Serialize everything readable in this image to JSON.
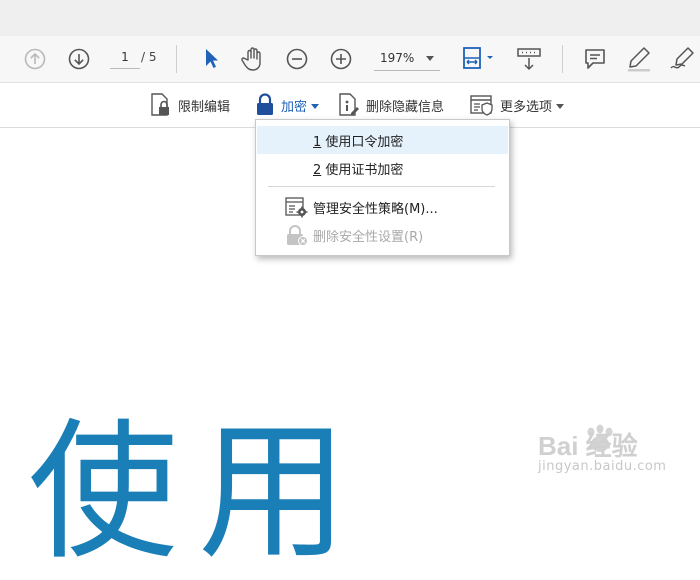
{
  "toolbar": {
    "page_current": "1",
    "page_total": "/ 5",
    "zoom": "197%",
    "icons": [
      "prev-page-icon",
      "next-page-icon",
      "select-arrow-icon",
      "hand-icon",
      "zoom-out-icon",
      "zoom-in-icon",
      "fit-page-icon",
      "scroll-mode-icon",
      "comment-icon",
      "highlight-pen-icon",
      "sign-icon"
    ]
  },
  "security_bar": {
    "restrict_edit": "限制编辑",
    "encrypt": "加密",
    "remove_hidden": "删除隐藏信息",
    "more_options": "更多选项"
  },
  "menu": {
    "item1_prefix": "1",
    "item1": " 使用口令加密",
    "item2_prefix": "2",
    "item2": " 使用证书加密",
    "item3": "管理安全性策略(M)...",
    "item4": "删除安全性设置(R)"
  },
  "document": {
    "big_text": "使用"
  },
  "watermark": {
    "logo": "Bai 经验",
    "url": "jingyan.baidu.com"
  },
  "colors": {
    "accent_blue": "#1a5fb4",
    "doc_text_blue": "#1a7fb6",
    "menu_highlight": "#e5f1fb"
  }
}
